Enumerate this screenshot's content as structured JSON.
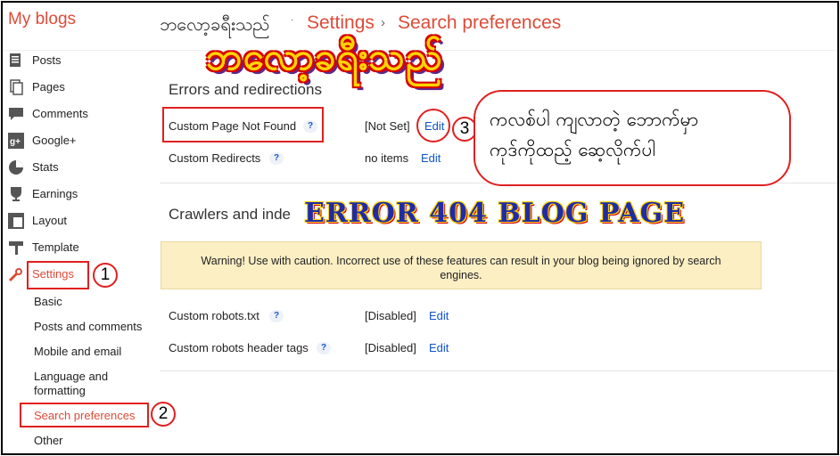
{
  "header": {
    "brand": "My blogs",
    "blog_name": "ဘလော့ခရီးသည်",
    "breadcrumb_dot": "·",
    "section": "Settings",
    "separator": "›",
    "page": "Search preferences"
  },
  "sidebar": {
    "items": [
      {
        "label": "Posts",
        "icon": "posts-icon"
      },
      {
        "label": "Pages",
        "icon": "pages-icon"
      },
      {
        "label": "Comments",
        "icon": "comments-icon"
      },
      {
        "label": "Google+",
        "icon": "google-plus-icon"
      },
      {
        "label": "Stats",
        "icon": "stats-icon"
      },
      {
        "label": "Earnings",
        "icon": "earnings-icon"
      },
      {
        "label": "Layout",
        "icon": "layout-icon"
      },
      {
        "label": "Template",
        "icon": "template-icon"
      },
      {
        "label": "Settings",
        "icon": "settings-wrench-icon"
      }
    ],
    "subitems": [
      "Basic",
      "Posts and comments",
      "Mobile and email",
      "Language and formatting",
      "Search preferences",
      "Other"
    ]
  },
  "errors": {
    "title": "Errors and redirections",
    "rows": [
      {
        "label": "Custom Page Not Found",
        "value": "[Not Set]",
        "action": "Edit"
      },
      {
        "label": "Custom Redirects",
        "value": "no items",
        "action": "Edit"
      }
    ]
  },
  "crawlers": {
    "title": "Crawlers and inde",
    "warning": "Warning! Use with caution. Incorrect use of these features can result in your blog being ignored by search engines.",
    "rows": [
      {
        "label": "Custom robots.txt",
        "value": "[Disabled]",
        "action": "Edit"
      },
      {
        "label": "Custom robots header tags",
        "value": "[Disabled]",
        "action": "Edit"
      }
    ]
  },
  "annotations": {
    "big_title": "ဘလော့ခရီးသည်",
    "bubble_line1": "ကလစ်ပါ ကျလာတဲ့ ဘောက်မှာ",
    "bubble_line2": "ကုဒ်ကိုထည့် ဆေ့လိုက်ပါ",
    "banner": "ERROR 404 BLOG PAGE",
    "step1": "1",
    "step2": "2",
    "step3": "3"
  },
  "help_glyph": "?",
  "colors": {
    "accent": "#dd4b39",
    "link": "#1155cc",
    "warning_bg": "#fcefc4",
    "annotation_red": "#e02020"
  }
}
